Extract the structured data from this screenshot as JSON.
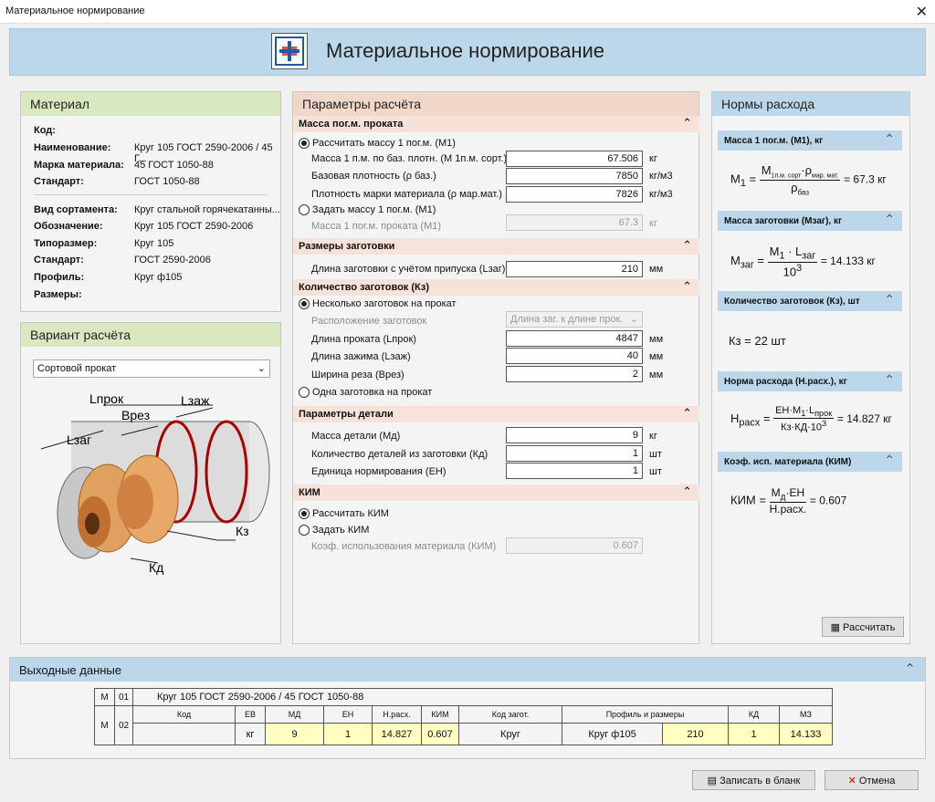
{
  "window": {
    "title": "Материальное нормирование",
    "close": "✕"
  },
  "header": {
    "title": "Материальное нормирование"
  },
  "material": {
    "title": "Материал",
    "rows": [
      {
        "k": "Код:",
        "v": ""
      },
      {
        "k": "Наименование:",
        "v": "Круг 105 ГОСТ 2590-2006 / 45 Г..."
      },
      {
        "k": "Марка материала:",
        "v": "45 ГОСТ 1050-88"
      },
      {
        "k": "Стандарт:",
        "v": "ГОСТ 1050-88"
      },
      {
        "k": "Вид сортамента:",
        "v": "Круг стальной горячекатанны..."
      },
      {
        "k": "Обозначение:",
        "v": "Круг 105 ГОСТ 2590-2006"
      },
      {
        "k": "Типоразмер:",
        "v": "Круг 105"
      },
      {
        "k": "Стандарт:",
        "v": "ГОСТ 2590-2006"
      },
      {
        "k": "Профиль:",
        "v": "Круг ф105"
      },
      {
        "k": "Размеры:",
        "v": ""
      }
    ]
  },
  "variant": {
    "title": "Вариант расчёта",
    "select": "Сортовой прокат",
    "labels": {
      "lprok": "Lпрок",
      "lzag": "Lзаг",
      "lzazh": "Lзаж",
      "vrez": "Bрез",
      "kz": "Кз",
      "kd": "Кд"
    }
  },
  "params": {
    "title": "Параметры расчёта",
    "s1": {
      "title": "Масса пог.м. проката",
      "r1": "Рассчитать массу 1 пог.м. (М1)",
      "f1": "Масса 1 п.м. по баз. плотн. (М 1п.м. сорт.)",
      "v1": "67.506",
      "u1": "кг",
      "f2": "Базовая плотность (ρ баз.)",
      "v2": "7850",
      "u2": "кг/м3",
      "f3": "Плотность марки материала (ρ мар.мат.)",
      "v3": "7826",
      "u3": "кг/м3",
      "r2": "Задать массу 1 пог.м. (М1)",
      "f4": "Масса 1 пог.м. проката (М1)",
      "v4": "67.3",
      "u4": "кг"
    },
    "s2": {
      "title": "Размеры заготовки",
      "f1": "Длина заготовки с учётом припуска (Lзаг)",
      "v1": "210",
      "u1": "мм"
    },
    "s3": {
      "title": "Количество заготовок (Кз)",
      "r1": "Несколько заготовок на прокат",
      "f0": "Расположение заготовок",
      "sel": "Длина заг. к длине прок.",
      "f1": "Длина проката (Lпрок)",
      "v1": "4847",
      "u1": "мм",
      "f2": "Длина зажима (Lзаж)",
      "v2": "40",
      "u2": "мм",
      "f3": "Ширина реза (Врез)",
      "v3": "2",
      "u3": "мм",
      "r2": "Одна заготовка на прокат"
    },
    "s4": {
      "title": "Параметры детали",
      "f1": "Масса детали (Мд)",
      "v1": "9",
      "u1": "кг",
      "f2": "Количество деталей из заготовки (Кд)",
      "v2": "1",
      "u2": "шт",
      "f3": "Единица нормирования (ЕН)",
      "v3": "1",
      "u3": "шт"
    },
    "s5": {
      "title": "КИМ",
      "r1": "Рассчитать КИМ",
      "r2": "Задать КИМ",
      "f1": "Коэф. использования материала (КИМ)",
      "v1": "0.607"
    }
  },
  "norms": {
    "title": "Нормы расхода",
    "n1": {
      "title": "Масса 1 пог.м. (М1), кг",
      "lhs": "М",
      "lsub": "1",
      "num": "М",
      "numsub": "1п.м. сорт",
      "rho": "ρ",
      "rhosub": "мар. мат.",
      "den": "ρ",
      "densub": "баз",
      "res": "= 67.3 кг"
    },
    "n2": {
      "title": "Масса заготовки (Мзаг), кг",
      "lhs": "М",
      "lsub": "заг",
      "num": "М",
      "numsub": "1",
      "dot": " · L",
      "dotsub": "заг",
      "den": "10",
      "densup": "3",
      "res": "= 14.133 кг"
    },
    "n3": {
      "title": "Количество заготовок (Кз), шт",
      "res": "Кз = 22 шт"
    },
    "n4": {
      "title": "Норма расхода (Н.расх.), кг",
      "lhs": "Н",
      "lsub": "расх",
      "num": "ЕН·М",
      "numsub": "1",
      "num2": "·L",
      "num2sub": "прок",
      "den": "Кз·КД·10",
      "densup": "3",
      "res": "= 14.827 кг"
    },
    "n5": {
      "title": "Коэф. исп. материала (КИМ)",
      "lhs": "КИМ =",
      "num": "М",
      "numsub": "д",
      "num2": "·ЕН",
      "den": "Н.расх.",
      "res": "= 0.607"
    },
    "calc": "Рассчитать"
  },
  "output": {
    "title": "Выходные данные",
    "r1": {
      "a": "М",
      "b": "01",
      "text": "Круг 105 ГОСТ 2590-2006 / 45 ГОСТ 1050-88"
    },
    "heads": [
      "Код",
      "ЕВ",
      "МД",
      "ЕН",
      "Н.расх.",
      "КИМ",
      "Код загот.",
      "Профиль и размеры",
      "КД",
      "МЗ"
    ],
    "r2": {
      "a": "М",
      "b": "02",
      "cells": [
        "",
        "кг",
        "9",
        "1",
        "14.827",
        "0.607",
        "Круг",
        "Круг ф105",
        "210",
        "1",
        "14.133"
      ]
    }
  },
  "buttons": {
    "write": "Записать в бланк",
    "cancel": "Отмена"
  }
}
